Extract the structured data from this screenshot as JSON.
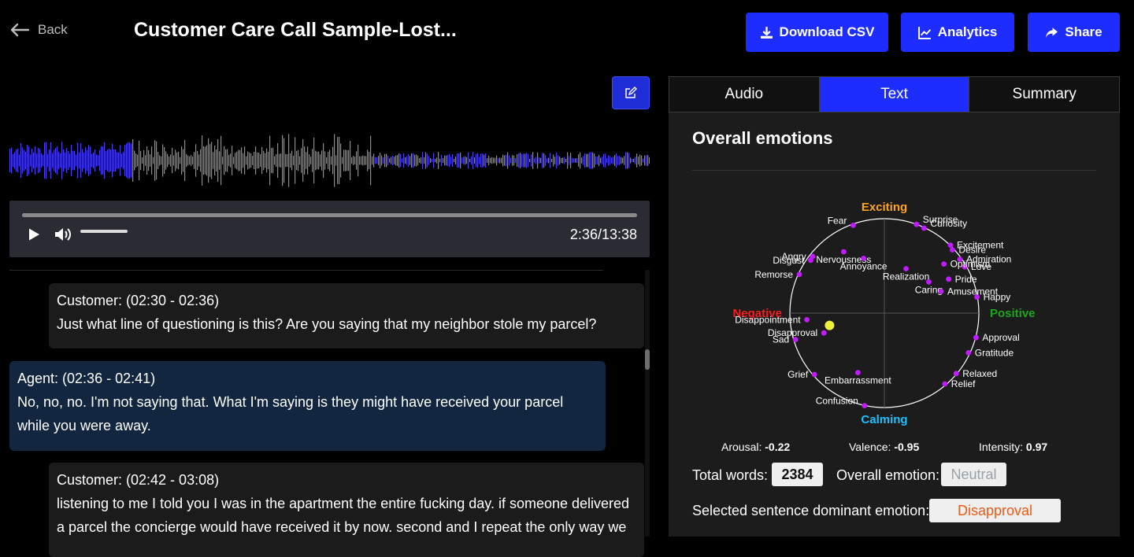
{
  "header": {
    "back_label": "Back",
    "title": "Customer Care Call Sample-Lost...",
    "buttons": [
      {
        "label": "Download CSV",
        "icon": "download-icon"
      },
      {
        "label": "Analytics",
        "icon": "chart-line-icon"
      },
      {
        "label": "Share",
        "icon": "share-icon"
      }
    ],
    "accent_color": "#1e2dff"
  },
  "player": {
    "time": "2:36/13:38",
    "played_fraction": 0.19,
    "wave_played_color": "#4b3ff0",
    "wave_unplayed_color": "#8a8a8a"
  },
  "transcript": [
    {
      "speaker": "Customer: (02:30 - 02:36)",
      "text": "Just what line of questioning is this? Are you saying that my neighbor stole my parcel?",
      "role": "customer"
    },
    {
      "speaker": "Agent: (02:36 - 02:41)",
      "text": "No, no, no. I'm not saying that. What I'm saying is they might have received your parcel while you were away.",
      "role": "agent"
    },
    {
      "speaker": "Customer: (02:42 - 03:08)",
      "text": "listening to me I told you I was in the apartment the entire fucking day. if someone delivered a parcel the concierge would have received it by now. second and I repeat the only way we",
      "role": "customer"
    }
  ],
  "tabs": [
    {
      "label": "Audio",
      "active": false
    },
    {
      "label": "Text",
      "active": true
    },
    {
      "label": "Summary",
      "active": false
    }
  ],
  "emotions": {
    "title": "Overall emotions",
    "axis_labels": {
      "top": "Exciting",
      "bottom": "Calming",
      "left": "Negative",
      "right": "Positive"
    },
    "axis_colors": {
      "top": "#ffa41b",
      "bottom": "#1ec0ff",
      "left": "#ff1a1a",
      "right": "#1ea51e"
    },
    "dot_color": "#c21bff",
    "selected_color": "#f0f03c",
    "points": [
      {
        "label": "Fear",
        "valence": -0.33,
        "arousal": 0.93
      },
      {
        "label": "Surprise",
        "valence": 0.34,
        "arousal": 0.94
      },
      {
        "label": "Curiosity",
        "valence": 0.42,
        "arousal": 0.9
      },
      {
        "label": "Excitement",
        "valence": 0.7,
        "arousal": 0.72
      },
      {
        "label": "Desire",
        "valence": 0.72,
        "arousal": 0.67
      },
      {
        "label": "Admiration",
        "valence": 0.8,
        "arousal": 0.57
      },
      {
        "label": "Love",
        "valence": 0.85,
        "arousal": 0.49
      },
      {
        "label": "Angry",
        "valence": -0.76,
        "arousal": 0.6
      },
      {
        "label": "Disgust",
        "valence": -0.78,
        "arousal": 0.56
      },
      {
        "label": "Nervousness",
        "valence": -0.43,
        "arousal": 0.65
      },
      {
        "label": "Annoyance",
        "valence": -0.22,
        "arousal": 0.58
      },
      {
        "label": "Remorse",
        "valence": -0.9,
        "arousal": 0.41
      },
      {
        "label": "Realization",
        "valence": 0.23,
        "arousal": 0.47
      },
      {
        "label": "Optimism",
        "valence": 0.63,
        "arousal": 0.52
      },
      {
        "label": "Caring",
        "valence": 0.47,
        "arousal": 0.33
      },
      {
        "label": "Pride",
        "valence": 0.68,
        "arousal": 0.36
      },
      {
        "label": "Amusement",
        "valence": 0.6,
        "arousal": 0.23
      },
      {
        "label": "Happy",
        "valence": 0.98,
        "arousal": 0.17
      },
      {
        "label": "Disappointment",
        "valence": -0.82,
        "arousal": -0.07
      },
      {
        "label": "Disapproval",
        "valence": -0.64,
        "arousal": -0.21
      },
      {
        "label": "Sad",
        "valence": -0.94,
        "arousal": -0.28
      },
      {
        "label": "Approval",
        "valence": 0.97,
        "arousal": -0.26
      },
      {
        "label": "Gratitude",
        "valence": 0.89,
        "arousal": -0.42
      },
      {
        "label": "Grief",
        "valence": -0.74,
        "arousal": -0.65
      },
      {
        "label": "Embarrassment",
        "valence": -0.28,
        "arousal": -0.63
      },
      {
        "label": "Relaxed",
        "valence": 0.76,
        "arousal": -0.64
      },
      {
        "label": "Relief",
        "valence": 0.64,
        "arousal": -0.75
      },
      {
        "label": "Confusion",
        "valence": -0.21,
        "arousal": -0.98
      }
    ],
    "selected_point": {
      "valence": -0.58,
      "arousal": -0.13
    }
  },
  "metrics": [
    {
      "label": "Arousal:",
      "value": "-0.22"
    },
    {
      "label": "Valence:",
      "value": "-0.95"
    },
    {
      "label": "Intensity:",
      "value": "0.97"
    }
  ],
  "summary": {
    "total_words_label": "Total words:",
    "total_words": "2384",
    "overall_emotion_label": "Overall emotion:",
    "overall_emotion": "Neutral",
    "selected_label": "Selected sentence dominant emotion:",
    "selected_emotion": "Disapproval",
    "neutral_color": "#9aa3a3",
    "disapproval_color": "#f05a14"
  }
}
